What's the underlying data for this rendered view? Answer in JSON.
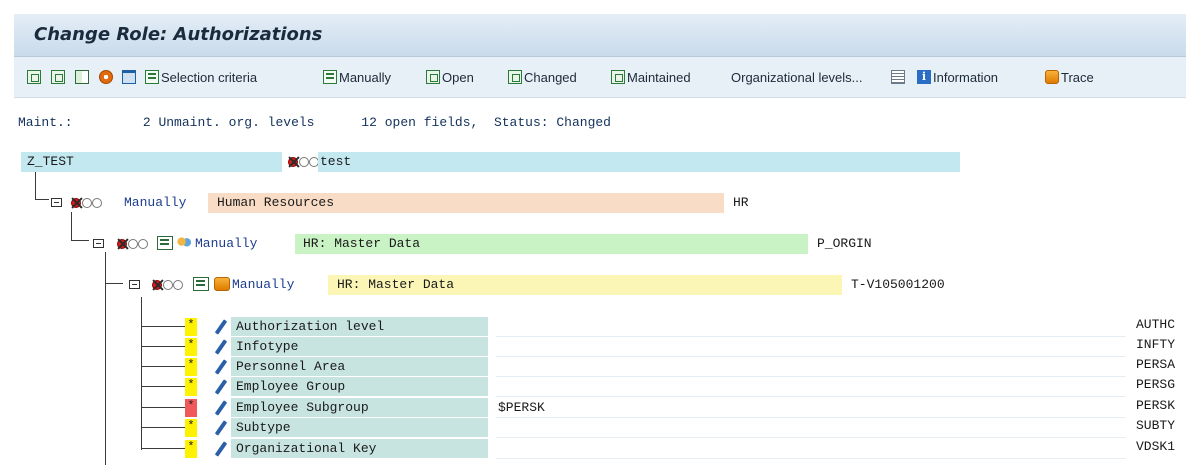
{
  "window": {
    "title": "Change Role: Authorizations"
  },
  "toolbar": {
    "selection_criteria": "Selection criteria",
    "manually": "Manually",
    "open": "Open",
    "changed": "Changed",
    "maintained": "Maintained",
    "organizational_levels": "Organizational levels...",
    "information": "Information",
    "trace": "Trace"
  },
  "status": {
    "maint_label": "Maint.:",
    "unmaint_count": "2",
    "unmaint_text": "Unmaint. org. levels",
    "open_count": "12",
    "open_text": "open fields,",
    "status_text": "Status: Changed"
  },
  "tree": {
    "root": {
      "name": "Z_TEST",
      "desc": "test"
    },
    "level1": {
      "mode": "Manually",
      "desc": "Human Resources",
      "code": "HR"
    },
    "level2": {
      "mode": "Manually",
      "desc": "HR: Master Data",
      "code": "P_ORGIN"
    },
    "level3": {
      "mode": "Manually",
      "desc": "HR: Master Data",
      "code": "T-V105001200"
    }
  },
  "fields": [
    {
      "marker": "*",
      "name": "Authorization level",
      "value": "",
      "key": "AUTHC",
      "status": "open"
    },
    {
      "marker": "*",
      "name": "Infotype",
      "value": "",
      "key": "INFTY",
      "status": "open"
    },
    {
      "marker": "*",
      "name": "Personnel Area",
      "value": "",
      "key": "PERSA",
      "status": "open"
    },
    {
      "marker": "*",
      "name": "Employee Group",
      "value": "",
      "key": "PERSG",
      "status": "open"
    },
    {
      "marker": "*",
      "name": "Employee Subgroup",
      "value": "$PERSK",
      "key": "PERSK",
      "status": "org-level"
    },
    {
      "marker": "*",
      "name": "Subtype",
      "value": "",
      "key": "SUBTY",
      "status": "open"
    },
    {
      "marker": "*",
      "name": "Organizational Key",
      "value": "",
      "key": "VDSK1",
      "status": "open"
    }
  ],
  "colors": {
    "root_bar": "#c4e8f0",
    "level1_bar": "#f8dcc6",
    "level2_bar": "#c9f2c5",
    "level3_bar": "#fbf6b6",
    "field_name_bg": "#c8e4e0",
    "open_marker": "#fff200",
    "org_marker": "#f05a5a"
  }
}
